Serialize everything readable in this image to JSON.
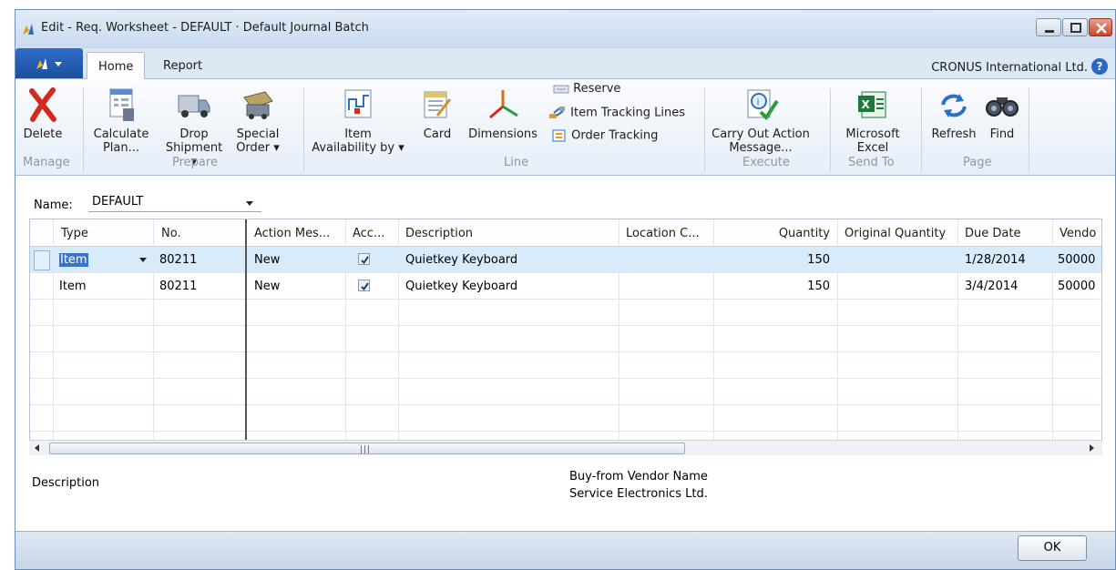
{
  "window": {
    "title": "Edit - Req. Worksheet - DEFAULT · Default Journal Batch",
    "company": "CRONUS International Ltd.",
    "help_glyph": "?"
  },
  "tabs": [
    {
      "label": "Home",
      "active": true
    },
    {
      "label": "Report",
      "active": false
    }
  ],
  "ribbon": {
    "manage": {
      "group": "Manage",
      "delete": "Delete"
    },
    "prepare": {
      "group": "Prepare",
      "calculate_plan": [
        "Calculate",
        "Plan..."
      ],
      "drop_shipment": [
        "Drop",
        "Shipment ▾"
      ],
      "special_order": [
        "Special",
        "Order ▾"
      ]
    },
    "line": {
      "group": "Line",
      "item_availability": [
        "Item",
        "Availability by ▾"
      ],
      "card": "Card",
      "dimensions": "Dimensions",
      "reserve": "Reserve",
      "item_tracking_lines": "Item Tracking Lines",
      "order_tracking": "Order Tracking"
    },
    "execute": {
      "group": "Execute",
      "carry_out": [
        "Carry Out Action",
        "Message..."
      ]
    },
    "send_to": {
      "group": "Send To",
      "excel": [
        "Microsoft",
        "Excel"
      ]
    },
    "page": {
      "group": "Page",
      "refresh": "Refresh",
      "find": "Find"
    }
  },
  "name_field": {
    "label": "Name:",
    "value": "DEFAULT"
  },
  "columns": [
    "Type",
    "No.",
    "Action Mes...",
    "Acc...",
    "Description",
    "Location C...",
    "Quantity",
    "Original Quantity",
    "Due Date",
    "Vendo"
  ],
  "rows": [
    {
      "type": "Item",
      "no": "80211",
      "action": "New",
      "accept": true,
      "description": "Quietkey Keyboard",
      "location": "",
      "quantity": "150",
      "original_quantity": "",
      "due_date": "1/28/2014",
      "vendor": "50000"
    },
    {
      "type": "Item",
      "no": "80211",
      "action": "New",
      "accept": true,
      "description": "Quietkey Keyboard",
      "location": "",
      "quantity": "150",
      "original_quantity": "",
      "due_date": "3/4/2014",
      "vendor": "50000"
    }
  ],
  "factbox": {
    "description_label": "Description",
    "vendor_label": "Buy-from Vendor Name",
    "vendor_value": "Service Electronics Ltd."
  },
  "footer": {
    "ok": "OK"
  },
  "icons": {
    "app_logo": "nav-logo-icon",
    "delete": "delete-x-icon",
    "calculate_plan": "calculator-sheet-icon",
    "drop_shipment": "truck-icon",
    "special_order": "special-order-icon",
    "item_availability": "availability-chart-icon",
    "card": "card-icon",
    "dimensions": "dimensions-axes-icon",
    "reserve": "reserve-icon",
    "item_tracking_lines": "item-tracking-icon",
    "order_tracking": "order-tracking-icon",
    "carry_out": "carry-out-action-icon",
    "excel": "excel-icon",
    "refresh": "refresh-icon",
    "find": "binoculars-icon"
  },
  "colors": {
    "accent": "#2f6cc7",
    "selected_row": "#d7ebfa",
    "delete_red": "#d42a1e",
    "excel_green": "#1d7a3a"
  }
}
